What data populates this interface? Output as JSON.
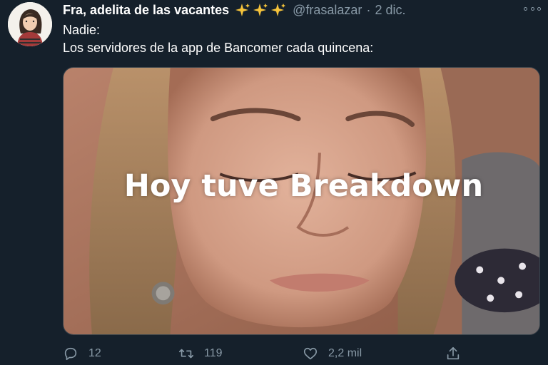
{
  "tweet": {
    "author_name": "Fra, adelita de las vacantes",
    "author_emoji": "✨✨✨",
    "handle": "@frasalazar",
    "separator": "·",
    "date": "2 dic.",
    "text_line1": "Nadie:",
    "text_line2": "Los servidores de la app de Bancomer cada quincena:",
    "media_caption": "Hoy tuve Breakdown"
  },
  "actions": {
    "replies": "12",
    "retweets": "119",
    "likes": "2,2 mil"
  },
  "colors": {
    "background": "#15202b",
    "secondary_text": "#8899a6",
    "sparkle": "#f5c33b",
    "border": "#38444d"
  },
  "icons": [
    "avatar",
    "sparkles-icon",
    "more-icon",
    "reply-icon",
    "retweet-icon",
    "like-icon",
    "share-icon"
  ]
}
